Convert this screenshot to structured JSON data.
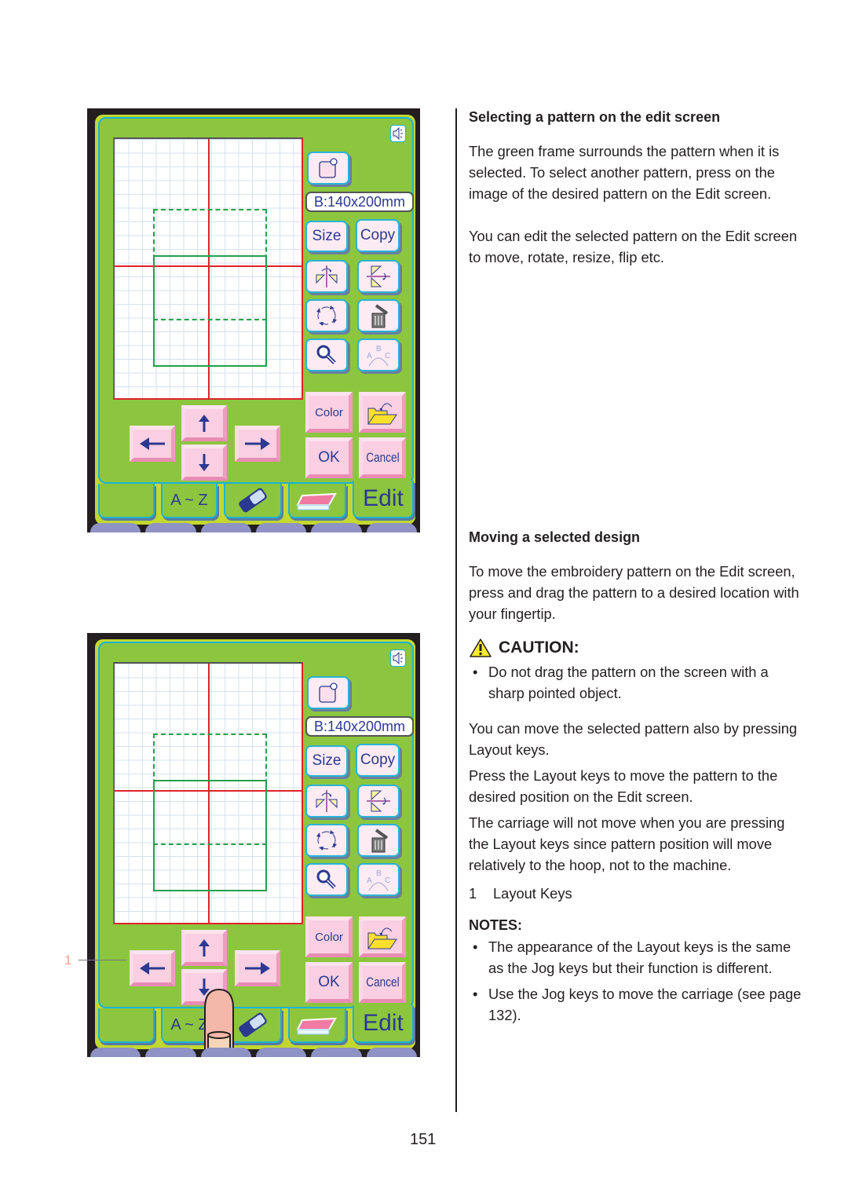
{
  "screens": [
    {
      "id": "top",
      "hoop_label": "B:140x200mm",
      "keys": {
        "size": "Size",
        "copy": "Copy",
        "color": "Color",
        "ok": "OK",
        "cancel": "Cancel"
      },
      "tabs": [
        "",
        "A ~ Z",
        "eraser",
        "hoop",
        "Edit"
      ],
      "icons": [
        "sound-icon",
        "new-pattern-icon",
        "mirror-vertical-icon",
        "mirror-horizontal-icon",
        "rotate-icon",
        "delete-icon",
        "zoom-icon",
        "arc-text-icon",
        "open-folder-icon",
        "arrow-up-icon",
        "arrow-down-icon",
        "arrow-left-icon",
        "arrow-right-icon"
      ]
    },
    {
      "id": "bottom",
      "hoop_label": "B:140x200mm",
      "keys": {
        "size": "Size",
        "copy": "Copy",
        "color": "Color",
        "ok": "OK",
        "cancel": "Cancel"
      },
      "tabs": [
        "",
        "A ~ Z",
        "eraser",
        "hoop",
        "Edit"
      ],
      "callout": "1"
    }
  ],
  "section1": {
    "heading": "Selecting a pattern on the edit screen",
    "p1": "The green frame surrounds the pattern when it is selected. To select another pattern, press on the image of the desired pattern on the Edit screen.",
    "p2": "You can edit the selected pattern on the Edit screen to move, rotate, resize, flip etc."
  },
  "section2": {
    "heading": "Moving a selected design",
    "p1": "To move the embroidery pattern on the Edit screen, press and drag the pattern to a desired location with your fingertip.",
    "caution_title": "CAUTION:",
    "caution_bullet": "Do not drag the pattern on the screen with a sharp pointed object.",
    "p2": "You can move the selected pattern also by pressing Layout keys.",
    "p3": "Press the Layout keys  to move the pattern to the desired position on the Edit screen.",
    "p4": "The carriage will not move when you are pressing the Layout keys since pattern position will move relatively to the hoop, not to the machine.",
    "legend_num": "1",
    "legend_label": "Layout Keys",
    "notes_title": "NOTES:",
    "notes": [
      "The appearance of the Layout keys is the same as the Jog keys but their function is different.",
      "Use the Jog keys to move the carriage (see page 132)."
    ]
  },
  "page_number": "151",
  "colors": {
    "screen_green": "#8cc63f",
    "frame_cyan": "#1bb3d3",
    "key_pink": "#f9cfe1",
    "icon_navy": "#2b3990",
    "hoop_red": "#e0222a",
    "selection_green": "#22a04b"
  }
}
